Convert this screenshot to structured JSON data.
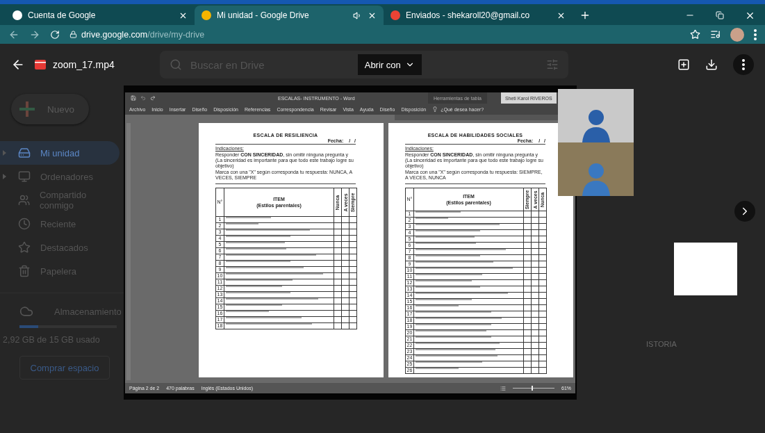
{
  "browser": {
    "tabs": [
      {
        "title": "Cuenta de Google",
        "selected": false,
        "audio": false
      },
      {
        "title": "Mi unidad - Google Drive",
        "selected": true,
        "audio": true
      },
      {
        "title": "Enviados - shekaroll20@gmail.co",
        "selected": false,
        "audio": false
      }
    ],
    "url_host": "drive.google.com",
    "url_path": "/drive/my-drive"
  },
  "drive_background": {
    "search_placeholder": "Buscar en Drive",
    "new_button": "Nuevo",
    "nav": [
      {
        "label": "Mi unidad",
        "selected": true,
        "expandable": true
      },
      {
        "label": "Ordenadores",
        "selected": false,
        "expandable": true
      },
      {
        "label": "Compartido conmigo",
        "selected": false,
        "expandable": false
      },
      {
        "label": "Reciente",
        "selected": false,
        "expandable": false
      },
      {
        "label": "Destacados",
        "selected": false,
        "expandable": false
      },
      {
        "label": "Papelera",
        "selected": false,
        "expandable": false
      }
    ],
    "storage": {
      "label": "Almacenamiento",
      "level": 0.19,
      "usage": "2,92 GB de 15 GB usado",
      "buy_button": "Comprar espacio"
    },
    "partial_text": "ISTORIA"
  },
  "viewer": {
    "file_name": "zoom_17.mp4",
    "open_with": "Abrir con",
    "word": {
      "title": "ESCALAS- INSTRUMENTO  -  Word",
      "context_tab": "Herramientas de tabla",
      "user": "Sheti Karol RIVEROS",
      "menu": [
        "Archivo",
        "Inicio",
        "Insertar",
        "Diseño",
        "Disposición",
        "Referencias",
        "Correspondencia",
        "Revisar",
        "Vista",
        "Ayuda",
        "Diseño",
        "Disposición"
      ],
      "tell_me": "¿Qué desea hacer?",
      "pages": [
        {
          "title": "ESCALA DE RESILIENCIA",
          "date_label": "Fecha:",
          "date_value": "/   /",
          "heading": "Indicaciones:",
          "instruction": "Responder **CON SINCERIDAD**, sin omitir ninguna pregunta y (La sinceridad es importante para que todo este trabajo logre su objetivo)",
          "marking": "Marca con una \"X\" según corresponda tu respuesta: NUNCA, A VECES, SIEMPRE",
          "number_header": "N°",
          "item_header": "ITEM",
          "item_subheader": "(Estilos parentales)",
          "answers": [
            "Nunca",
            "A veces",
            "Siempre"
          ],
          "rows": [
            "1",
            "2",
            "3",
            "4",
            "5",
            "6",
            "7",
            "8",
            "9",
            "10",
            "11",
            "12",
            "13",
            "14",
            "15",
            "16",
            "17",
            "18"
          ]
        },
        {
          "title": "ESCALA DE HABILIDADES SOCIALES",
          "date_label": "Fecha:",
          "date_value": "/   /",
          "heading": "Indicaciones:",
          "instruction": "Responder **CON SINCERIDAD**, sin omitir ninguna pregunta y (La sinceridad es importante para que todo este trabajo logre su objetivo)",
          "marking": "Marca con una \"X\" según corresponda tu respuesta: SIEMPRE, A VECES, NUNCA",
          "number_header": "N°",
          "item_header": "ITEM",
          "item_subheader": "(Estilos parentales)",
          "answers": [
            "Siempre",
            "A veces",
            "Nunca"
          ],
          "rows": [
            "1",
            "2",
            "3",
            "4",
            "5",
            "6",
            "7",
            "8",
            "9",
            "10",
            "11",
            "12",
            "13",
            "14",
            "15",
            "16",
            "17",
            "18",
            "19",
            "20",
            "21",
            "22",
            "23",
            "24",
            "25",
            "26"
          ]
        }
      ],
      "status": {
        "page": "Página 2 de 2",
        "words": "470 palabras",
        "language": "Inglés (Estados Unidos)",
        "zoom": "61%",
        "zoom_slider": {
          "level": 0.45
        }
      }
    }
  }
}
